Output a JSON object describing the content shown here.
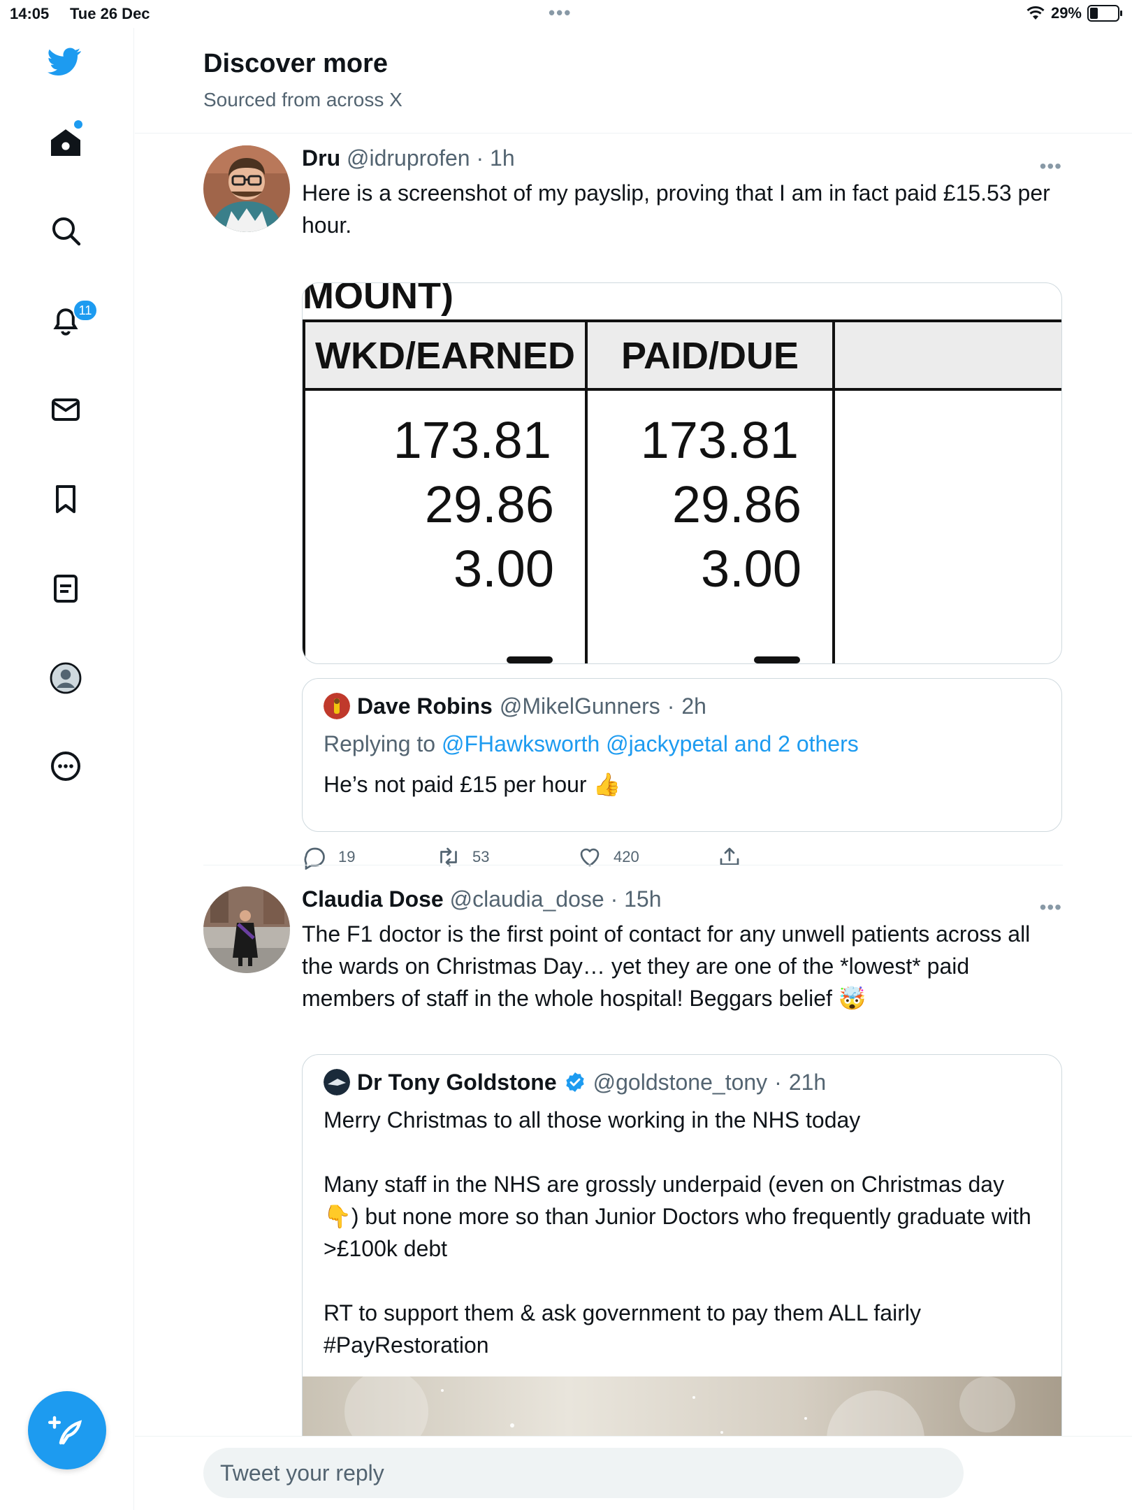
{
  "status_bar": {
    "time": "14:05",
    "date": "Tue 26 Dec",
    "battery": "29%",
    "battery_level": 0.29
  },
  "sidebar": {
    "items": [
      {
        "name": "logo",
        "icon": "twitter-bird-icon"
      },
      {
        "name": "home",
        "icon": "home-icon",
        "has_dot": true
      },
      {
        "name": "search",
        "icon": "search-icon"
      },
      {
        "name": "notifications",
        "icon": "bell-icon",
        "badge": "11"
      },
      {
        "name": "messages",
        "icon": "envelope-icon"
      },
      {
        "name": "bookmarks",
        "icon": "bookmark-icon"
      },
      {
        "name": "lists",
        "icon": "list-icon"
      },
      {
        "name": "profile",
        "icon": "avatar-icon"
      },
      {
        "name": "more",
        "icon": "more-circle-icon"
      }
    ],
    "compose_icon": "compose-feather-icon"
  },
  "header": {
    "title": "Discover more",
    "subtitle": "Sourced from across X"
  },
  "tweets": [
    {
      "name": "Dru",
      "handle": "@idruprofen",
      "time": "1h",
      "text": "Here is a screenshot of my payslip, proving that I am in fact paid £15.53 per hour.",
      "media": {
        "heading": "MOUNT)",
        "col1": "WKD/EARNED",
        "col2": "PAID/DUE",
        "rows": [
          [
            "173.81",
            "173.81"
          ],
          [
            "29.86",
            "29.86"
          ],
          [
            "3.00",
            "3.00"
          ]
        ]
      },
      "quote": {
        "name": "Dave Robins",
        "handle": "@MikelGunners",
        "time": "2h",
        "replying_prefix": "Replying to",
        "replying_to": "@FHawksworth @jackypetal and 2 others",
        "text": "He’s not paid £15 per hour 👍"
      },
      "stats": {
        "replies": "19",
        "retweets": "53",
        "likes": "420"
      }
    },
    {
      "name": "Claudia Dose",
      "handle": "@claudia_dose",
      "time": "15h",
      "text": "The F1 doctor is the first point of contact for any unwell patients across all the wards on Christmas Day… yet they are one of the *lowest* paid members of staff in the whole hospital! Beggars belief 🤯",
      "quote": {
        "name": "Dr Tony Goldstone",
        "verified": true,
        "handle": "@goldstone_tony",
        "time": "21h",
        "paragraphs": [
          "Merry Christmas to all those working in the NHS today",
          "Many staff in the NHS are grossly underpaid (even on Christmas day 👇) but none more so than Junior Doctors who frequently graduate with >£100k debt",
          "RT to support them & ask government to pay them ALL fairly #PayRestoration"
        ]
      }
    }
  ],
  "reply": {
    "placeholder": "Tweet your reply"
  },
  "colors": {
    "accent": "#1d9bf0",
    "text": "#0f1419",
    "muted": "#536471",
    "border": "#cfd9de"
  }
}
